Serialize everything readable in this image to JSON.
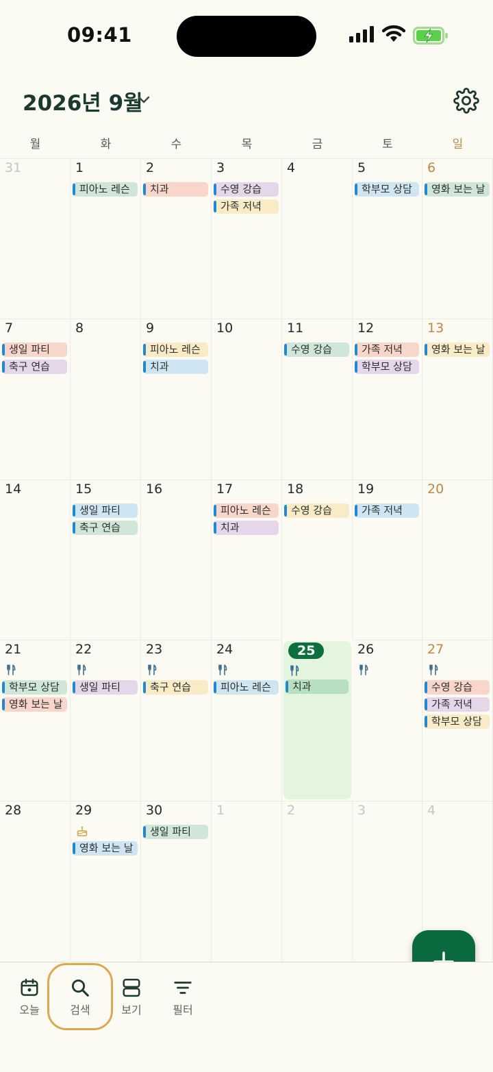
{
  "status": {
    "time": "09:41"
  },
  "header": {
    "month_title": "2026년 9월"
  },
  "weekdays": [
    "월",
    "화",
    "수",
    "목",
    "금",
    "토",
    "일"
  ],
  "weeks": [
    [
      {
        "day": "31",
        "muted": true,
        "events": []
      },
      {
        "day": "1",
        "events": [
          {
            "title": "피아노 레슨",
            "color": "green"
          }
        ]
      },
      {
        "day": "2",
        "events": [
          {
            "title": "치과",
            "color": "pink"
          }
        ]
      },
      {
        "day": "3",
        "events": [
          {
            "title": "수영 강습",
            "color": "purple"
          },
          {
            "title": "가족 저녁",
            "color": "yellow"
          }
        ]
      },
      {
        "day": "4",
        "events": []
      },
      {
        "day": "5",
        "events": [
          {
            "title": "학부모 상담",
            "color": "blue"
          }
        ]
      },
      {
        "day": "6",
        "sun": true,
        "events": [
          {
            "title": "영화 보는 날",
            "color": "green"
          }
        ]
      }
    ],
    [
      {
        "day": "7",
        "events": [
          {
            "title": "생일 파티",
            "color": "pink"
          },
          {
            "title": "축구 연습",
            "color": "purple"
          }
        ]
      },
      {
        "day": "8",
        "events": []
      },
      {
        "day": "9",
        "events": [
          {
            "title": "피아노 레슨",
            "color": "yellow"
          },
          {
            "title": "치과",
            "color": "blue"
          }
        ]
      },
      {
        "day": "10",
        "events": []
      },
      {
        "day": "11",
        "events": [
          {
            "title": "수영 강습",
            "color": "green"
          }
        ]
      },
      {
        "day": "12",
        "events": [
          {
            "title": "가족 저녁",
            "color": "pink"
          },
          {
            "title": "학부모 상담",
            "color": "purple"
          }
        ]
      },
      {
        "day": "13",
        "sun": true,
        "events": [
          {
            "title": "영화 보는 날",
            "color": "yellow"
          }
        ]
      }
    ],
    [
      {
        "day": "14",
        "events": []
      },
      {
        "day": "15",
        "events": [
          {
            "title": "생일 파티",
            "color": "blue"
          },
          {
            "title": "축구 연습",
            "color": "green"
          }
        ]
      },
      {
        "day": "16",
        "events": []
      },
      {
        "day": "17",
        "events": [
          {
            "title": "피아노 레슨",
            "color": "pink"
          },
          {
            "title": "치과",
            "color": "purple"
          }
        ]
      },
      {
        "day": "18",
        "events": [
          {
            "title": "수영 강습",
            "color": "yellow"
          }
        ]
      },
      {
        "day": "19",
        "events": [
          {
            "title": "가족 저녁",
            "color": "blue"
          }
        ]
      },
      {
        "day": "20",
        "sun": true,
        "events": []
      }
    ],
    [
      {
        "day": "21",
        "meal": true,
        "events": [
          {
            "title": "학부모 상담",
            "color": "green"
          },
          {
            "title": "영화 보는 날",
            "color": "pink"
          }
        ]
      },
      {
        "day": "22",
        "meal": true,
        "events": [
          {
            "title": "생일 파티",
            "color": "purple"
          }
        ]
      },
      {
        "day": "23",
        "meal": true,
        "events": [
          {
            "title": "축구 연습",
            "color": "yellow"
          }
        ]
      },
      {
        "day": "24",
        "meal": true,
        "events": [
          {
            "title": "피아노 레슨",
            "color": "blue"
          }
        ]
      },
      {
        "day": "25",
        "today": true,
        "meal": true,
        "events": [
          {
            "title": "치과",
            "color": "todaygreen"
          }
        ]
      },
      {
        "day": "26",
        "meal": true,
        "events": []
      },
      {
        "day": "27",
        "sun": true,
        "meal": true,
        "events": [
          {
            "title": "수영 강습",
            "color": "pink"
          },
          {
            "title": "가족 저녁",
            "color": "purple"
          },
          {
            "title": "학부모 상담",
            "color": "yellow"
          }
        ]
      }
    ],
    [
      {
        "day": "28",
        "events": []
      },
      {
        "day": "29",
        "cake": true,
        "events": [
          {
            "title": "영화 보는 날",
            "color": "blue"
          }
        ]
      },
      {
        "day": "30",
        "events": [
          {
            "title": "생일 파티",
            "color": "green"
          }
        ]
      },
      {
        "day": "1",
        "muted": true,
        "events": []
      },
      {
        "day": "2",
        "muted": true,
        "events": []
      },
      {
        "day": "3",
        "muted": true,
        "events": []
      },
      {
        "day": "4",
        "muted": true,
        "events": []
      }
    ]
  ],
  "tabs": [
    {
      "label": "오늘",
      "icon": "calendar-today-icon"
    },
    {
      "label": "검색",
      "icon": "search-icon"
    },
    {
      "label": "보기",
      "icon": "view-layout-icon"
    },
    {
      "label": "필터",
      "icon": "filter-icon"
    }
  ],
  "colors": {
    "accent": "#0b6a3d",
    "sunday": "#b88a43",
    "highlight": "#dca84d",
    "event_bar": "#1e88d6"
  }
}
